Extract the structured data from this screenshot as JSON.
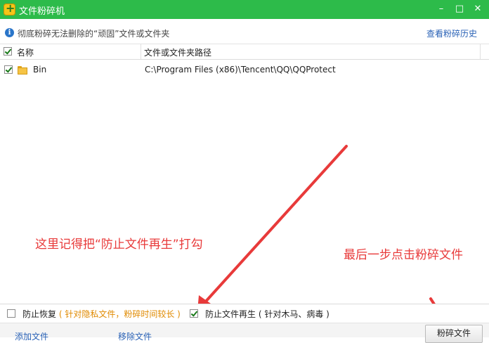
{
  "window": {
    "title": "文件粉碎机",
    "minimize_glyph": "–",
    "maximize_glyph": "□",
    "close_glyph": "✕"
  },
  "infobar": {
    "icon": "info-icon",
    "icon_glyph": "i",
    "text": "彻底粉碎无法删除的“顽固”文件或文件夹",
    "history_link": "查看粉碎历史"
  },
  "table": {
    "columns": [
      "名称",
      "文件或文件夹路径"
    ],
    "rows": [
      {
        "checked": true,
        "icon": "folder-icon",
        "name": "Bin",
        "path": "C:\\Program Files (x86)\\Tencent\\QQ\\QQProtect"
      }
    ]
  },
  "annotations": {
    "note1": "这里记得把“防止文件再生”打勾",
    "note2": "最后一步点击粉碎文件",
    "arrow_color": "#e83a3a"
  },
  "options": {
    "prevent_recover": {
      "checked": false,
      "label": "防止恢复",
      "hint": "( 针对隐私文件，粉碎时间较长 )"
    },
    "prevent_regen": {
      "checked": true,
      "label": "防止文件再生",
      "hint": "( 针对木马、病毒 )"
    }
  },
  "footer": {
    "add_file": "添加文件",
    "remove_file": "移除文件",
    "shred_button": "粉碎文件"
  },
  "colors": {
    "titlebar": "#2dbb4a",
    "link": "#2a62b6",
    "annotation": "#e83a3a",
    "hint": "#e08a00"
  }
}
